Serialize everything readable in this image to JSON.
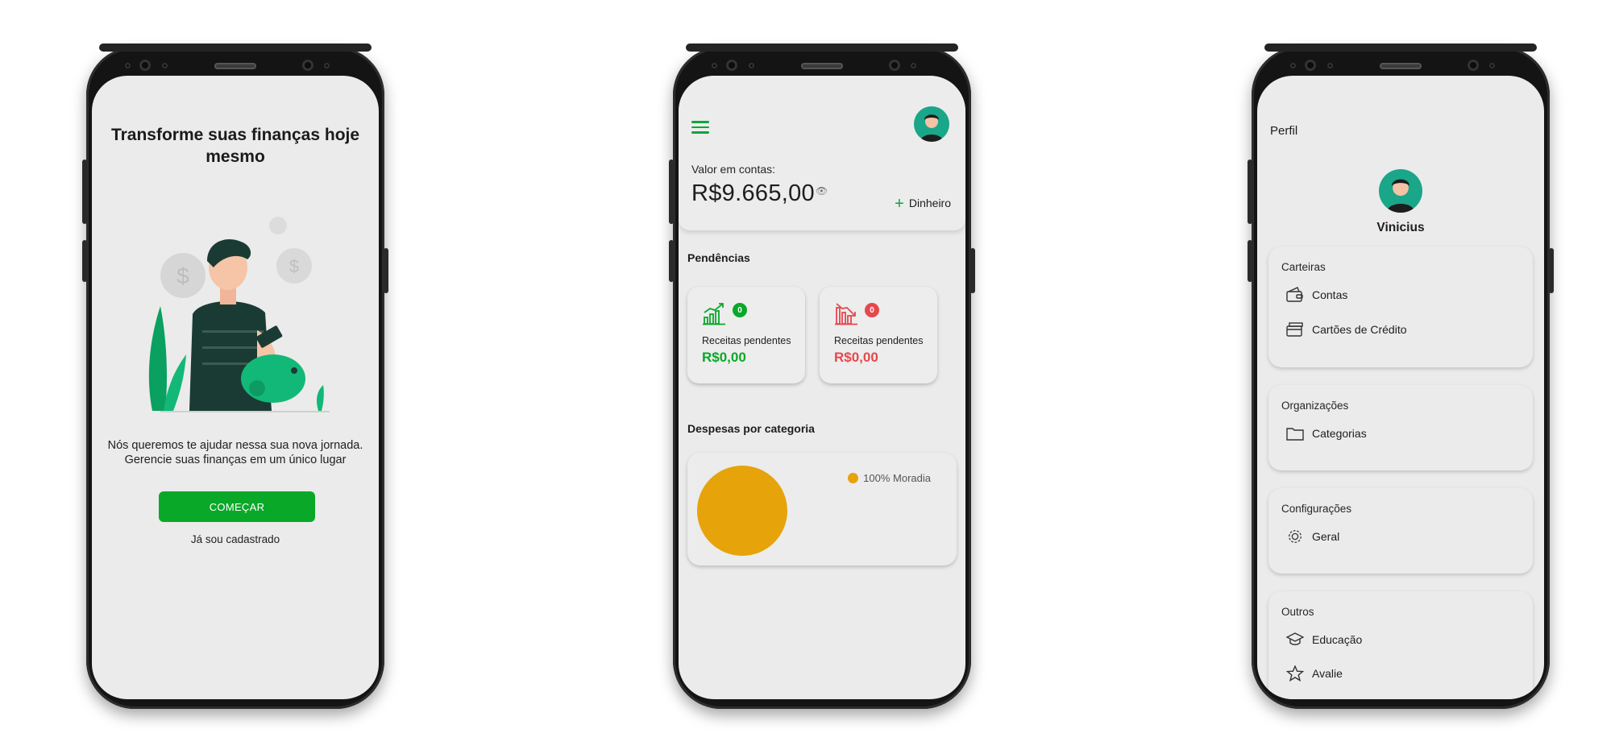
{
  "intro": {
    "title": "Transforme suas finanças hoje mesmo",
    "text_line1": "Nós queremos te ajudar nessa sua nova jornada.",
    "text_line2": "Gerencie suas finanças em um único lugar",
    "start_button": "COMEÇAR",
    "already_registered": "Já sou cadastrado"
  },
  "dashboard": {
    "accounts_label": "Valor em contas:",
    "balance": "R$9.665,00",
    "add_cash_label": "Dinheiro",
    "pending_title": "Pendências",
    "pending": [
      {
        "count": "0",
        "label": "Receitas pendentes",
        "value": "R$0,00",
        "color": "#0aa828"
      },
      {
        "count": "0",
        "label": "Receitas pendentes",
        "value": "R$0,00",
        "color": "#e5484d"
      }
    ],
    "expenses_title": "Despesas por categoria",
    "legend_label": "100% Moradia"
  },
  "chart_data": {
    "type": "pie",
    "title": "Despesas por categoria",
    "categories": [
      "Moradia"
    ],
    "values": [
      100
    ],
    "colors": [
      "#e6a30a"
    ],
    "legend_placement": "top-right"
  },
  "profile": {
    "title": "Perfil",
    "user_name": "Vinicius",
    "groups": [
      {
        "title": "Carteiras",
        "items": [
          {
            "label": "Contas",
            "icon": "wallet-icon"
          },
          {
            "label": "Cartões de Crédito",
            "icon": "credit-card-icon"
          }
        ]
      },
      {
        "title": "Organizações",
        "items": [
          {
            "label": "Categorias",
            "icon": "folder-icon"
          }
        ]
      },
      {
        "title": "Configurações",
        "items": [
          {
            "label": "Geral",
            "icon": "gear-icon"
          }
        ]
      },
      {
        "title": "Outros",
        "items": [
          {
            "label": "Educação",
            "icon": "graduation-cap-icon"
          },
          {
            "label": "Avalie",
            "icon": "star-icon"
          }
        ]
      }
    ]
  },
  "colors": {
    "brand_green": "#0aa828",
    "alert_red": "#e5484d",
    "avatar_teal": "#1aa688",
    "chart_yellow": "#e6a30a"
  }
}
